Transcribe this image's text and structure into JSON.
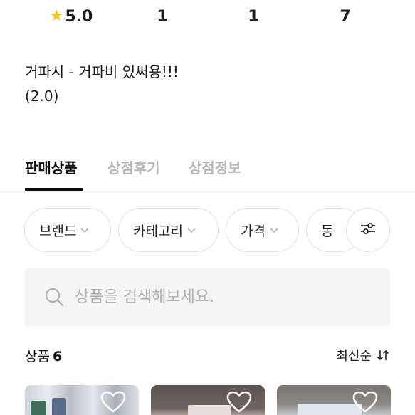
{
  "stats": {
    "rating": "5.0",
    "stat1": "1",
    "stat2": "1",
    "stat3": "7"
  },
  "description": {
    "line1": "거파시 - 거파비 있써용!!!",
    "line2": "(2.0)"
  },
  "tabs": [
    {
      "label": "판매상품",
      "active": true
    },
    {
      "label": "상점후기",
      "active": false
    },
    {
      "label": "상점정보",
      "active": false
    }
  ],
  "filters": [
    {
      "label": "브랜드"
    },
    {
      "label": "카테고리"
    },
    {
      "label": "가격"
    },
    {
      "label": "동"
    }
  ],
  "search": {
    "placeholder": "상품을 검색해보세요."
  },
  "products": {
    "label": "상품",
    "count": "6",
    "sort_label": "최신순"
  },
  "colors": {
    "accent_star": "#f5c518",
    "text_primary": "#111111",
    "text_muted": "#b8b8b8"
  },
  "icons": [
    "star-icon",
    "chevron-down-icon",
    "filter-sliders-icon",
    "search-icon",
    "sort-icon",
    "heart-icon"
  ]
}
